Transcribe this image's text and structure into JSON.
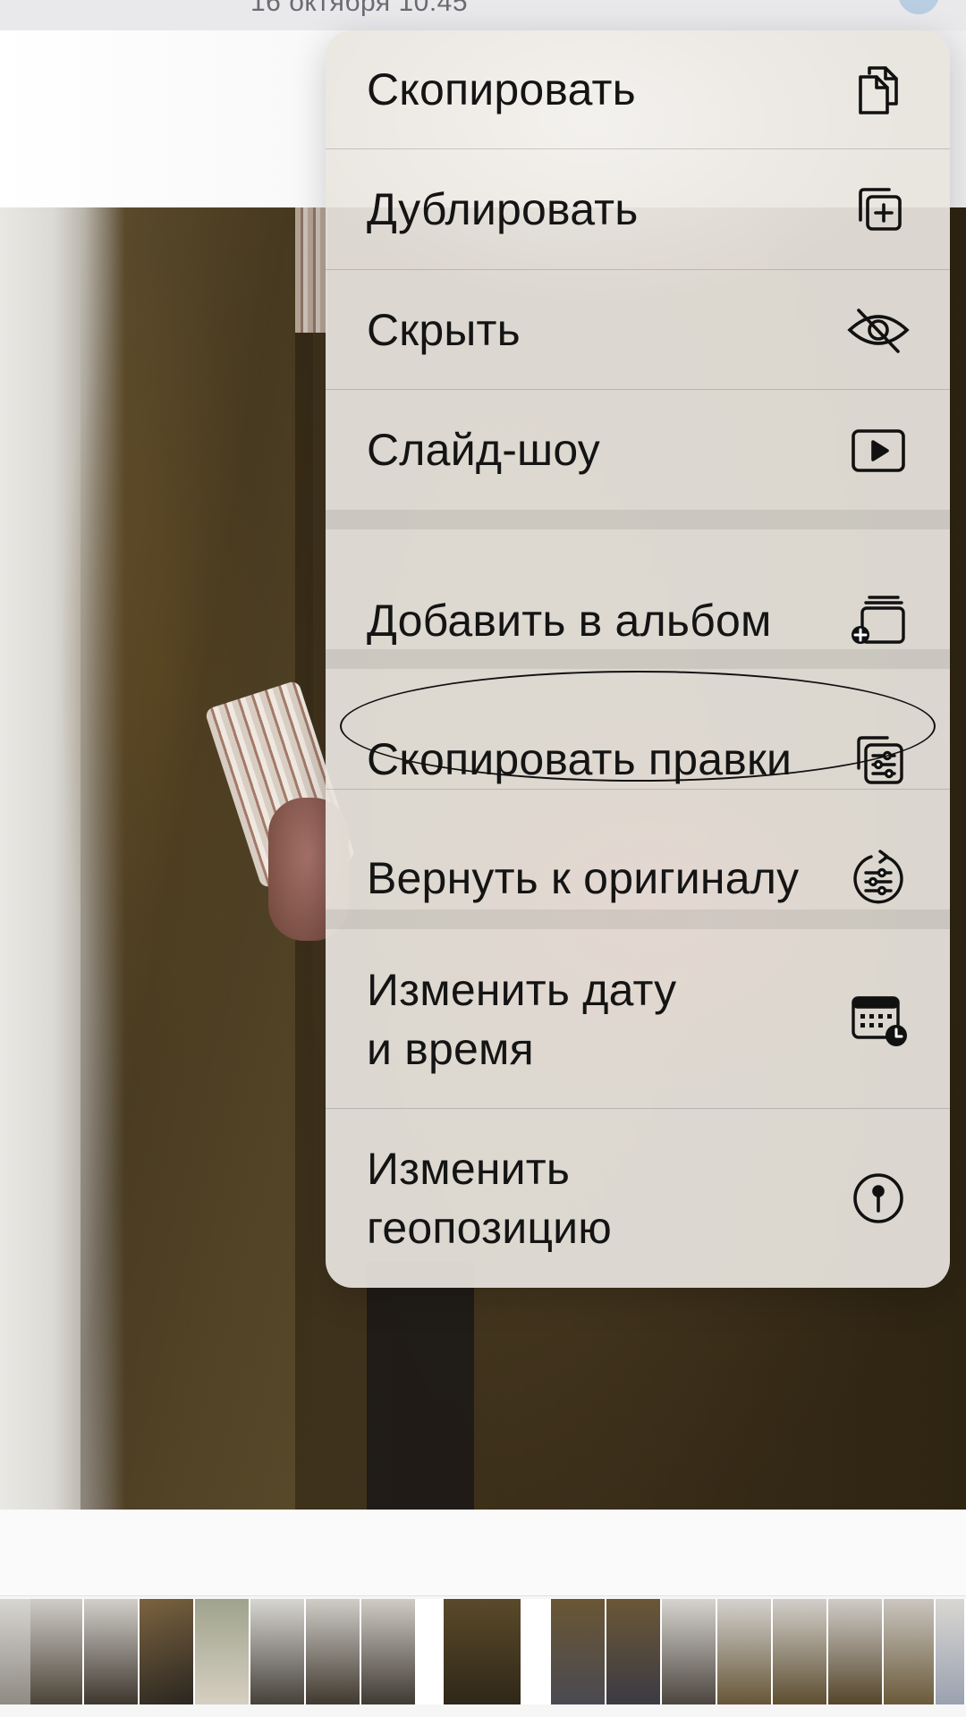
{
  "status_bar": {
    "date_text": "16 октября 10:45"
  },
  "menu": {
    "items": [
      {
        "id": "copy",
        "label": "Скопировать",
        "icon": "copy-icon"
      },
      {
        "id": "duplicate",
        "label": "Дублировать",
        "icon": "duplicate-icon"
      },
      {
        "id": "hide",
        "label": "Скрыть",
        "icon": "eye-slash-icon"
      },
      {
        "id": "slideshow",
        "label": "Слайд-шоу",
        "icon": "play-icon"
      },
      {
        "id": "add-to-album",
        "label": "Добавить в альбом",
        "icon": "add-to-album-icon"
      },
      {
        "id": "copy-edits",
        "label": "Скопировать правки",
        "icon": "copy-edits-icon"
      },
      {
        "id": "revert",
        "label": "Вернуть к оригиналу",
        "icon": "revert-icon"
      },
      {
        "id": "adjust-date",
        "label": "Изменить дату\nи время",
        "icon": "calendar-clock-icon"
      },
      {
        "id": "adjust-location",
        "label": "Изменить\nгеопозицию",
        "icon": "location-pin-icon"
      }
    ]
  },
  "annotation": {
    "highlighted_item": "copy-edits"
  },
  "colors": {
    "menu_background": "#e8e4de",
    "text": "#141414",
    "photo_coat": "#5a4a2b"
  }
}
